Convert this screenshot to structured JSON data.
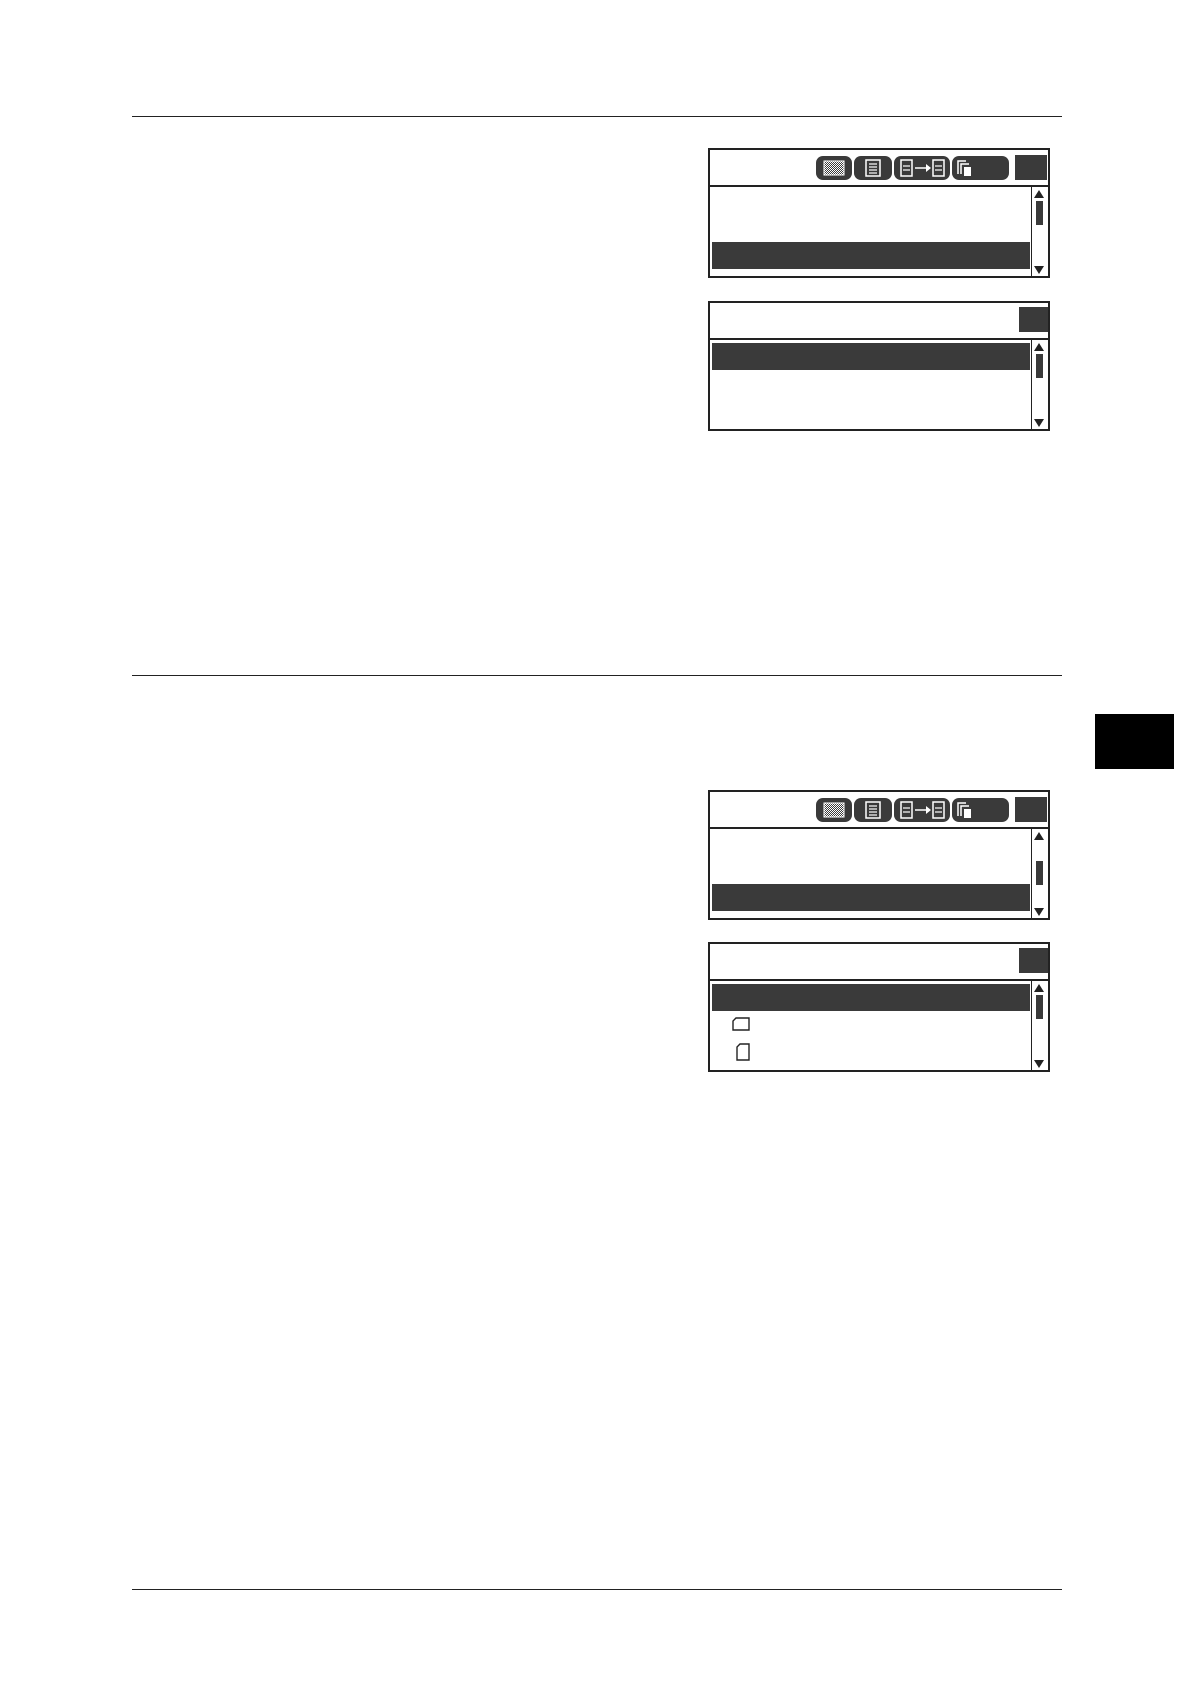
{
  "page": {
    "colors": {
      "rule": "#222222",
      "highlight": "#3a3a3a",
      "tab": "#000000"
    },
    "panels": [
      {
        "id": "panel-1",
        "type": "copy-status",
        "icons": [
          "image-quality-icon",
          "original-type-icon",
          "duplex-icon",
          "collate-icon"
        ],
        "scroll_position": 0.0,
        "highlighted_row": 3
      },
      {
        "id": "panel-2",
        "type": "submenu",
        "scroll_position": 0.0,
        "highlighted_row": 1
      },
      {
        "id": "panel-3",
        "type": "copy-status",
        "icons": [
          "image-quality-icon",
          "original-type-icon",
          "duplex-icon",
          "collate-icon"
        ],
        "scroll_position": 0.5,
        "highlighted_row": 3
      },
      {
        "id": "panel-4",
        "type": "submenu",
        "scroll_position": 0.0,
        "highlighted_row": 1,
        "row_icons": [
          "",
          "landscape-paper-icon",
          "portrait-paper-icon"
        ]
      }
    ]
  }
}
